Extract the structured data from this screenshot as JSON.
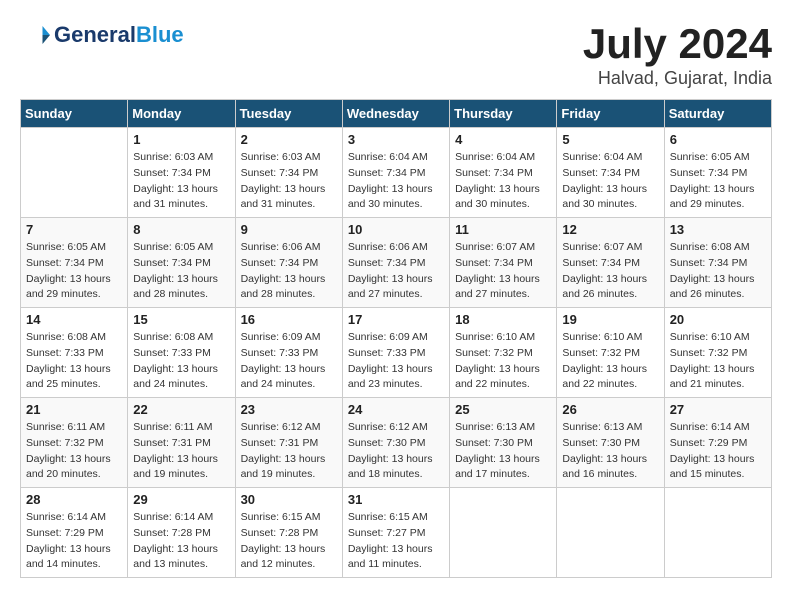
{
  "header": {
    "logo_line1": "General",
    "logo_line2": "Blue",
    "month_year": "July 2024",
    "location": "Halvad, Gujarat, India"
  },
  "weekdays": [
    "Sunday",
    "Monday",
    "Tuesday",
    "Wednesday",
    "Thursday",
    "Friday",
    "Saturday"
  ],
  "weeks": [
    [
      {
        "day": "",
        "info": ""
      },
      {
        "day": "1",
        "info": "Sunrise: 6:03 AM\nSunset: 7:34 PM\nDaylight: 13 hours\nand 31 minutes."
      },
      {
        "day": "2",
        "info": "Sunrise: 6:03 AM\nSunset: 7:34 PM\nDaylight: 13 hours\nand 31 minutes."
      },
      {
        "day": "3",
        "info": "Sunrise: 6:04 AM\nSunset: 7:34 PM\nDaylight: 13 hours\nand 30 minutes."
      },
      {
        "day": "4",
        "info": "Sunrise: 6:04 AM\nSunset: 7:34 PM\nDaylight: 13 hours\nand 30 minutes."
      },
      {
        "day": "5",
        "info": "Sunrise: 6:04 AM\nSunset: 7:34 PM\nDaylight: 13 hours\nand 30 minutes."
      },
      {
        "day": "6",
        "info": "Sunrise: 6:05 AM\nSunset: 7:34 PM\nDaylight: 13 hours\nand 29 minutes."
      }
    ],
    [
      {
        "day": "7",
        "info": "Sunrise: 6:05 AM\nSunset: 7:34 PM\nDaylight: 13 hours\nand 29 minutes."
      },
      {
        "day": "8",
        "info": "Sunrise: 6:05 AM\nSunset: 7:34 PM\nDaylight: 13 hours\nand 28 minutes."
      },
      {
        "day": "9",
        "info": "Sunrise: 6:06 AM\nSunset: 7:34 PM\nDaylight: 13 hours\nand 28 minutes."
      },
      {
        "day": "10",
        "info": "Sunrise: 6:06 AM\nSunset: 7:34 PM\nDaylight: 13 hours\nand 27 minutes."
      },
      {
        "day": "11",
        "info": "Sunrise: 6:07 AM\nSunset: 7:34 PM\nDaylight: 13 hours\nand 27 minutes."
      },
      {
        "day": "12",
        "info": "Sunrise: 6:07 AM\nSunset: 7:34 PM\nDaylight: 13 hours\nand 26 minutes."
      },
      {
        "day": "13",
        "info": "Sunrise: 6:08 AM\nSunset: 7:34 PM\nDaylight: 13 hours\nand 26 minutes."
      }
    ],
    [
      {
        "day": "14",
        "info": "Sunrise: 6:08 AM\nSunset: 7:33 PM\nDaylight: 13 hours\nand 25 minutes."
      },
      {
        "day": "15",
        "info": "Sunrise: 6:08 AM\nSunset: 7:33 PM\nDaylight: 13 hours\nand 24 minutes."
      },
      {
        "day": "16",
        "info": "Sunrise: 6:09 AM\nSunset: 7:33 PM\nDaylight: 13 hours\nand 24 minutes."
      },
      {
        "day": "17",
        "info": "Sunrise: 6:09 AM\nSunset: 7:33 PM\nDaylight: 13 hours\nand 23 minutes."
      },
      {
        "day": "18",
        "info": "Sunrise: 6:10 AM\nSunset: 7:32 PM\nDaylight: 13 hours\nand 22 minutes."
      },
      {
        "day": "19",
        "info": "Sunrise: 6:10 AM\nSunset: 7:32 PM\nDaylight: 13 hours\nand 22 minutes."
      },
      {
        "day": "20",
        "info": "Sunrise: 6:10 AM\nSunset: 7:32 PM\nDaylight: 13 hours\nand 21 minutes."
      }
    ],
    [
      {
        "day": "21",
        "info": "Sunrise: 6:11 AM\nSunset: 7:32 PM\nDaylight: 13 hours\nand 20 minutes."
      },
      {
        "day": "22",
        "info": "Sunrise: 6:11 AM\nSunset: 7:31 PM\nDaylight: 13 hours\nand 19 minutes."
      },
      {
        "day": "23",
        "info": "Sunrise: 6:12 AM\nSunset: 7:31 PM\nDaylight: 13 hours\nand 19 minutes."
      },
      {
        "day": "24",
        "info": "Sunrise: 6:12 AM\nSunset: 7:30 PM\nDaylight: 13 hours\nand 18 minutes."
      },
      {
        "day": "25",
        "info": "Sunrise: 6:13 AM\nSunset: 7:30 PM\nDaylight: 13 hours\nand 17 minutes."
      },
      {
        "day": "26",
        "info": "Sunrise: 6:13 AM\nSunset: 7:30 PM\nDaylight: 13 hours\nand 16 minutes."
      },
      {
        "day": "27",
        "info": "Sunrise: 6:14 AM\nSunset: 7:29 PM\nDaylight: 13 hours\nand 15 minutes."
      }
    ],
    [
      {
        "day": "28",
        "info": "Sunrise: 6:14 AM\nSunset: 7:29 PM\nDaylight: 13 hours\nand 14 minutes."
      },
      {
        "day": "29",
        "info": "Sunrise: 6:14 AM\nSunset: 7:28 PM\nDaylight: 13 hours\nand 13 minutes."
      },
      {
        "day": "30",
        "info": "Sunrise: 6:15 AM\nSunset: 7:28 PM\nDaylight: 13 hours\nand 12 minutes."
      },
      {
        "day": "31",
        "info": "Sunrise: 6:15 AM\nSunset: 7:27 PM\nDaylight: 13 hours\nand 11 minutes."
      },
      {
        "day": "",
        "info": ""
      },
      {
        "day": "",
        "info": ""
      },
      {
        "day": "",
        "info": ""
      }
    ]
  ]
}
